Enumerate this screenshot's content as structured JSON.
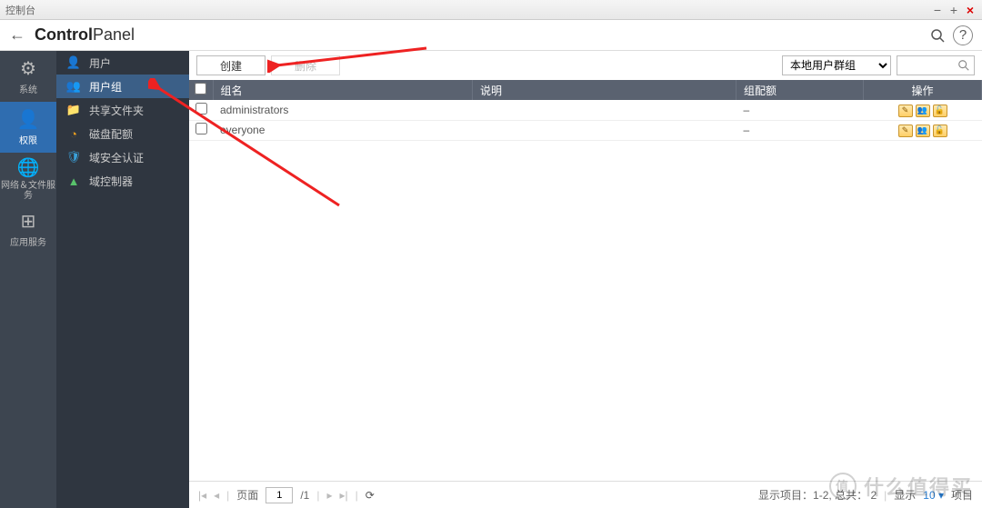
{
  "window": {
    "title": "控制台"
  },
  "header": {
    "title_bold": "Control",
    "title_light": "Panel"
  },
  "iconbar": {
    "items": [
      {
        "label": "系统",
        "glyph": "⚙"
      },
      {
        "label": "权限",
        "glyph": "👤"
      },
      {
        "label": "网络＆文件服务",
        "glyph": "🌐"
      },
      {
        "label": "应用服务",
        "glyph": "⊞"
      }
    ]
  },
  "sidebar": {
    "items": [
      {
        "label": "用户"
      },
      {
        "label": "用户组"
      },
      {
        "label": "共享文件夹"
      },
      {
        "label": "磁盘配额"
      },
      {
        "label": "域安全认证"
      },
      {
        "label": "域控制器"
      }
    ]
  },
  "toolbar": {
    "create_label": "创建",
    "delete_label": "删除",
    "filter_selected": "本地用户群组"
  },
  "table": {
    "headers": {
      "name": "组名",
      "desc": "说明",
      "quota": "组配额",
      "op": "操作"
    },
    "rows": [
      {
        "name": "administrators",
        "desc": "",
        "quota": "–"
      },
      {
        "name": "everyone",
        "desc": "",
        "quota": "–"
      }
    ]
  },
  "pager": {
    "page_label": "页面",
    "page_value": "1",
    "page_total": "/1",
    "status_prefix": "显示项目：",
    "status_range": "1-2,",
    "status_total_label": "总共：",
    "status_total": "2",
    "show_label": "显示",
    "show_value": "10",
    "item_label": "项目"
  },
  "watermark": {
    "badge": "值",
    "text": "什么值得买"
  }
}
